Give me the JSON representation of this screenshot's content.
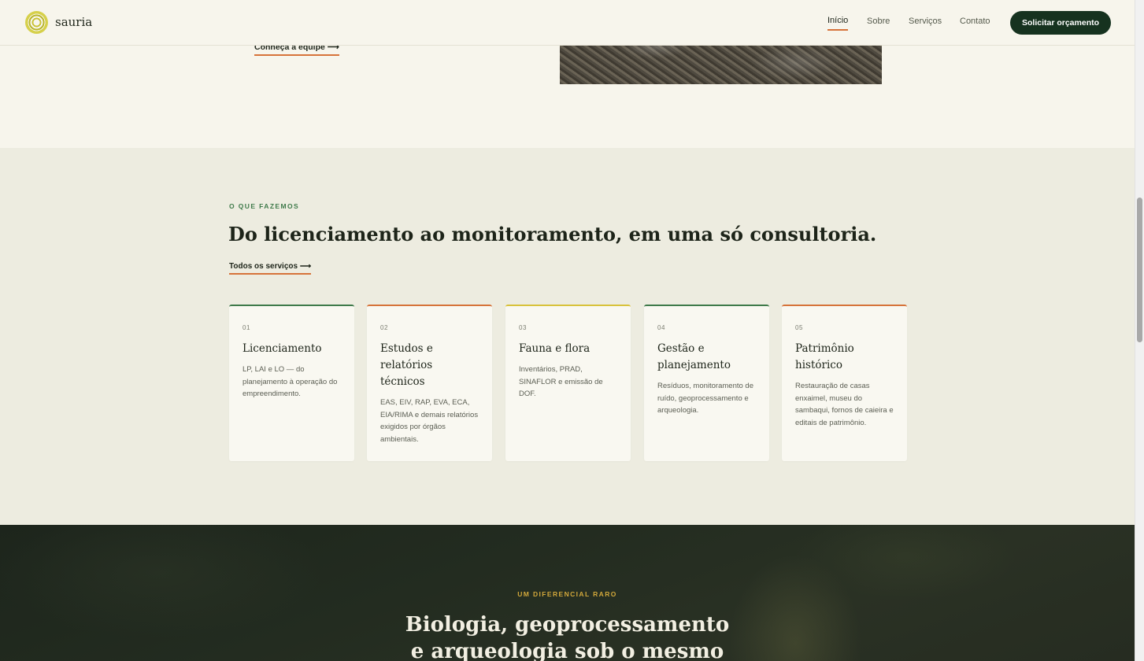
{
  "header": {
    "brand": "sauria",
    "nav": [
      {
        "label": "Início",
        "active": true
      },
      {
        "label": "Sobre",
        "active": false
      },
      {
        "label": "Serviços",
        "active": false
      },
      {
        "label": "Contato",
        "active": false
      }
    ],
    "cta_label": "Solicitar orçamento"
  },
  "about": {
    "team_link": "Conheça a equipe ⟶"
  },
  "services": {
    "eyebrow": "O QUE FAZEMOS",
    "headline": "Do licenciamento ao monitoramento, em uma só consultoria.",
    "all_link": "Todos os serviços ⟶",
    "cards": [
      {
        "num": "01",
        "title": "Licenciamento",
        "desc": "LP, LAI e LO — do planejamento à operação do empreendimento.",
        "accent": "#3f7a4a"
      },
      {
        "num": "02",
        "title": "Estudos e relatórios técnicos",
        "desc": "EAS, EIV, RAP, EVA, ECA, EIA/RIMA e demais relatórios exigidos por órgãos ambientais.",
        "accent": "#d6733a"
      },
      {
        "num": "03",
        "title": "Fauna e flora",
        "desc": "Inventários, PRAD, SINAFLOR e emissão de DOF.",
        "accent": "#d8c23b"
      },
      {
        "num": "04",
        "title": "Gestão e planejamento",
        "desc": "Resíduos, monitoramento de ruído, geoprocessamento e arqueologia.",
        "accent": "#3f7a4a"
      },
      {
        "num": "05",
        "title": "Patrimônio histórico",
        "desc": "Restauração de casas enxaimel, museu do sambaqui, fornos de caieira e editais de patrimônio.",
        "accent": "#d6733a"
      }
    ]
  },
  "differential": {
    "eyebrow": "UM DIFERENCIAL RARO",
    "headline": "Biologia, geoprocessamento e arqueologia sob o mesmo teto."
  },
  "colors": {
    "primary": "#16321f",
    "accent_orange": "#d6733a",
    "accent_green": "#3f7a4a",
    "accent_yellow": "#d2a83b"
  }
}
